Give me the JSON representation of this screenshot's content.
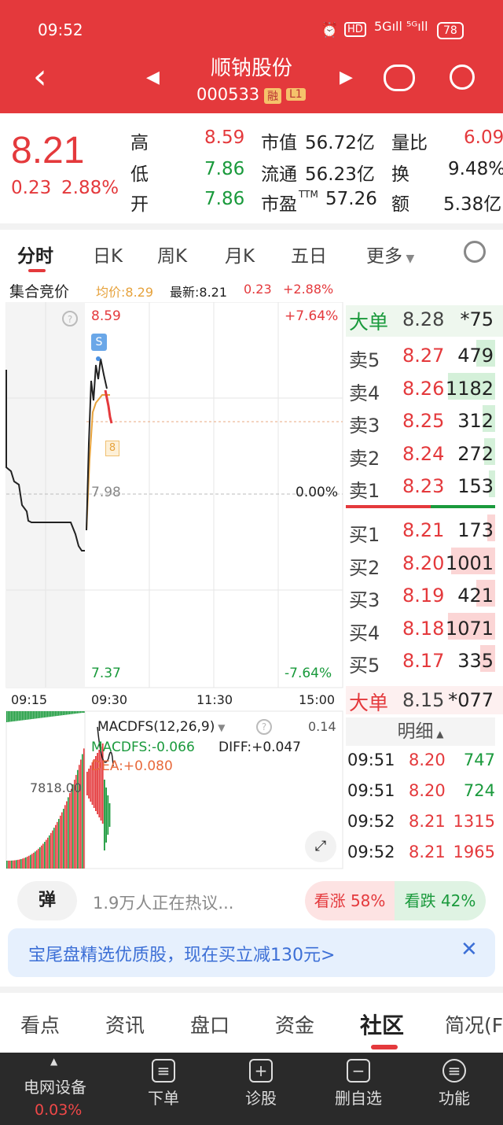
{
  "status_bar": {
    "time": "09:52",
    "battery": "78"
  },
  "header": {
    "stock_name": "顺钠股份",
    "stock_code": "000533",
    "badge_rong": "融",
    "badge_l1": "L1"
  },
  "quote": {
    "price": "8.21",
    "change": "0.23",
    "change_pct": "2.88%",
    "high_label": "高",
    "high": "8.59",
    "low_label": "低",
    "low": "7.86",
    "open_label": "开",
    "open": "7.86",
    "mktcap_label": "市值",
    "mktcap": "56.72亿",
    "float_label": "流通",
    "float": "56.23亿",
    "pe_label": "市盈",
    "pe_tm": "TTM",
    "pe": "57.26",
    "vol_ratio_label": "量比",
    "vol_ratio": "6.09",
    "turnover_label": "换",
    "turnover": "9.48%",
    "amount_label": "额",
    "amount": "5.38亿"
  },
  "tabs": [
    "分时",
    "日K",
    "周K",
    "月K",
    "五日",
    "更多"
  ],
  "chart_info": {
    "auction": "集合竞价",
    "avg": "均价:8.29",
    "latest": "最新:8.21",
    "chg": "0.23",
    "pct": "+2.88%"
  },
  "chart": {
    "top_price": "8.59",
    "mid_price": "7.98",
    "bottom_price": "7.37",
    "top_pct": "+7.64%",
    "mid_pct": "0.00%",
    "bottom_pct": "-7.64%",
    "marker_s": "S",
    "marker_8": "8",
    "times": [
      "09:15",
      "09:30",
      "11:30",
      "15:00"
    ]
  },
  "macd": {
    "title": "MACDFS(12,26,9)",
    "macd": "MACDFS:-0.066",
    "diff": "DIFF:+0.047",
    "dea": "DEA:+0.080",
    "top": "0.14",
    "vol": "7818.00"
  },
  "orderbook": {
    "big_top": {
      "label": "大单",
      "price": "8.28",
      "vol": "*75"
    },
    "asks": [
      {
        "label": "卖5",
        "price": "8.27",
        "vol": "479"
      },
      {
        "label": "卖4",
        "price": "8.26",
        "vol": "1182"
      },
      {
        "label": "卖3",
        "price": "8.25",
        "vol": "312"
      },
      {
        "label": "卖2",
        "price": "8.24",
        "vol": "272"
      },
      {
        "label": "卖1",
        "price": "8.23",
        "vol": "153"
      }
    ],
    "bids": [
      {
        "label": "买1",
        "price": "8.21",
        "vol": "173"
      },
      {
        "label": "买2",
        "price": "8.20",
        "vol": "1001"
      },
      {
        "label": "买3",
        "price": "8.19",
        "vol": "421"
      },
      {
        "label": "买4",
        "price": "8.18",
        "vol": "1071"
      },
      {
        "label": "买5",
        "price": "8.17",
        "vol": "335"
      }
    ],
    "big_bottom": {
      "label": "大单",
      "price": "8.15",
      "vol": "*077"
    },
    "detail_label": "明细",
    "ticks": [
      {
        "time": "09:51",
        "price": "8.20",
        "vol": "747"
      },
      {
        "time": "09:51",
        "price": "8.20",
        "vol": "724"
      },
      {
        "time": "09:52",
        "price": "8.21",
        "vol": "1315"
      },
      {
        "time": "09:52",
        "price": "8.21",
        "vol": "1965"
      }
    ]
  },
  "discussion": {
    "danmu": "弹",
    "text": "1.9万人正在热议...",
    "up": "看涨 58%",
    "down": "看跌 42%"
  },
  "banner": {
    "text": "宝尾盘精选优质股，现在买立减130元>"
  },
  "content_tabs": [
    "看点",
    "资讯",
    "盘口",
    "资金",
    "社区",
    "简况(F"
  ],
  "bottom_nav": {
    "sector": "电网设备",
    "sector_pct": "0.03%",
    "items": [
      "下单",
      "诊股",
      "删自选",
      "功能"
    ]
  }
}
